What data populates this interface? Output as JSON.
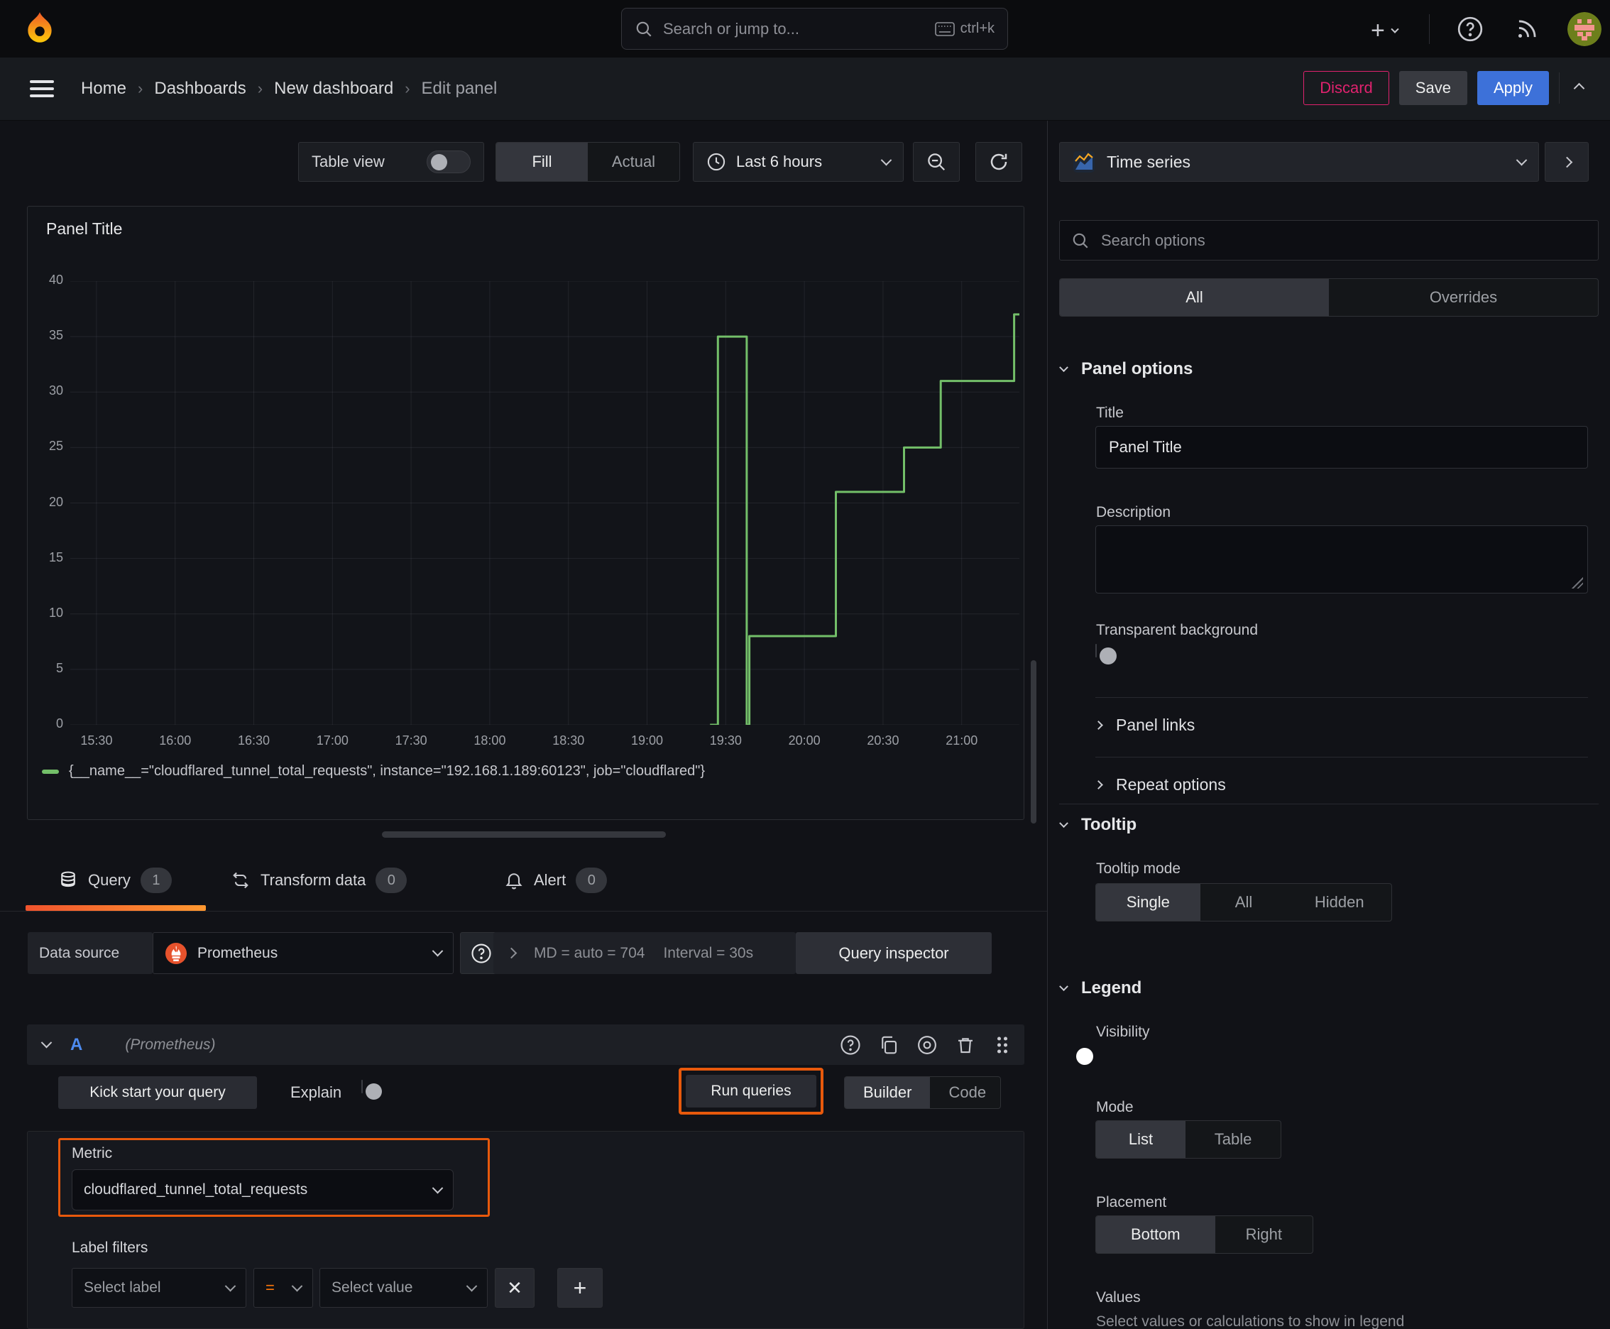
{
  "topnav": {
    "search_placeholder": "Search or jump to...",
    "shortcut": "ctrl+k"
  },
  "breadcrumb": {
    "items": [
      "Home",
      "Dashboards",
      "New dashboard",
      "Edit panel"
    ],
    "discard_label": "Discard",
    "save_label": "Save",
    "apply_label": "Apply"
  },
  "toolbar": {
    "table_view_label": "Table view",
    "fill_label": "Fill",
    "actual_label": "Actual",
    "time_range_label": "Last 6 hours"
  },
  "panel": {
    "title": "Panel Title",
    "legend": "{__name__=\"cloudflared_tunnel_total_requests\", instance=\"192.168.1.189:60123\", job=\"cloudflared\"}"
  },
  "chart_data": {
    "type": "line",
    "line_style": "stepped",
    "title": "Panel Title",
    "x_range": [
      "15:20",
      "21:22"
    ],
    "ylim": [
      0,
      40
    ],
    "xticks": [
      "15:30",
      "16:00",
      "16:30",
      "17:00",
      "17:30",
      "18:00",
      "18:30",
      "19:00",
      "19:30",
      "20:00",
      "20:30",
      "21:00"
    ],
    "yticks": [
      0,
      5,
      10,
      15,
      20,
      25,
      30,
      35,
      40
    ],
    "grid": true,
    "legend_position": "bottom",
    "series": [
      {
        "name": "{__name__=\"cloudflared_tunnel_total_requests\", instance=\"192.168.1.189:60123\", job=\"cloudflared\"}",
        "color": "#73bf69",
        "points": [
          [
            "19:24",
            0
          ],
          [
            "19:27",
            0
          ],
          [
            "19:27",
            35
          ],
          [
            "19:38",
            35
          ],
          [
            "19:38",
            0
          ],
          [
            "19:39",
            0
          ],
          [
            "19:39",
            8
          ],
          [
            "20:12",
            8
          ],
          [
            "20:12",
            21
          ],
          [
            "20:38",
            21
          ],
          [
            "20:38",
            25
          ],
          [
            "20:52",
            25
          ],
          [
            "20:52",
            31
          ],
          [
            "21:20",
            31
          ],
          [
            "21:20",
            37
          ],
          [
            "21:22",
            37
          ]
        ]
      }
    ]
  },
  "tabs": {
    "query_label": "Query",
    "query_count": "1",
    "transform_label": "Transform data",
    "transform_count": "0",
    "alert_label": "Alert",
    "alert_count": "0"
  },
  "datasource_row": {
    "label": "Data source",
    "value": "Prometheus",
    "stats_md": "MD = auto = 704",
    "stats_interval": "Interval = 30s",
    "inspector_label": "Query inspector"
  },
  "query_editor": {
    "ref_id": "A",
    "ds_hint": "(Prometheus)",
    "kick_start_label": "Kick start your query",
    "explain_label": "Explain",
    "run_queries_label": "Run queries",
    "builder_label": "Builder",
    "code_label": "Code",
    "metric_label": "Metric",
    "metric_value": "cloudflared_tunnel_total_requests",
    "label_filters_label": "Label filters",
    "select_label_placeholder": "Select label",
    "operator": "=",
    "select_value_placeholder": "Select value"
  },
  "options_pane": {
    "viz_type": "Time series",
    "search_placeholder": "Search options",
    "tab_all": "All",
    "tab_overrides": "Overrides",
    "panel_options_header": "Panel options",
    "title_label": "Title",
    "title_value": "Panel Title",
    "description_label": "Description",
    "transparent_label": "Transparent background",
    "panel_links_label": "Panel links",
    "repeat_options_label": "Repeat options",
    "tooltip_header": "Tooltip",
    "tooltip_mode_label": "Tooltip mode",
    "tooltip_single": "Single",
    "tooltip_all": "All",
    "tooltip_hidden": "Hidden",
    "legend_header": "Legend",
    "visibility_label": "Visibility",
    "mode_label": "Mode",
    "mode_list": "List",
    "mode_table": "Table",
    "placement_label": "Placement",
    "placement_bottom": "Bottom",
    "placement_right": "Right",
    "values_label": "Values",
    "values_desc": "Select values or calculations to show in legend"
  },
  "colors": {
    "accent_orange": "#e8590c",
    "tab_underline_from": "#f0532d",
    "tab_underline_to": "#ff9830",
    "series_green": "#73bf69",
    "primary_blue": "#3d71d9",
    "discard_pink": "#e0226e"
  }
}
